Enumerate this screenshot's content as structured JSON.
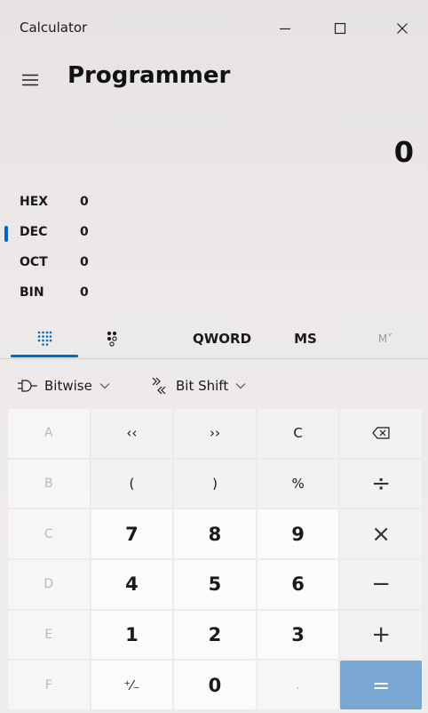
{
  "window": {
    "title": "Calculator"
  },
  "header": {
    "mode": "Programmer"
  },
  "display": {
    "value": "0"
  },
  "radix": [
    {
      "label": "HEX",
      "value": "0",
      "selected": false
    },
    {
      "label": "DEC",
      "value": "0",
      "selected": true
    },
    {
      "label": "OCT",
      "value": "0",
      "selected": false
    },
    {
      "label": "BIN",
      "value": "0",
      "selected": false
    }
  ],
  "toolbar": {
    "word_size": "QWORD",
    "memory_store": "MS",
    "memory_view": "M˅"
  },
  "ops": {
    "bitwise_label": "Bitwise",
    "bitshift_label": "Bit Shift"
  },
  "keypad": [
    [
      "A",
      "‹‹",
      "››",
      "C",
      "⌫"
    ],
    [
      "B",
      "(",
      ")",
      "%",
      "÷"
    ],
    [
      "C",
      "7",
      "8",
      "9",
      "×"
    ],
    [
      "D",
      "4",
      "5",
      "6",
      "−"
    ],
    [
      "E",
      "1",
      "2",
      "3",
      "+"
    ],
    [
      "F",
      "⁺⁄₋",
      "0",
      ".",
      "="
    ]
  ],
  "colors": {
    "accent": "#0067c0",
    "equals_button": "#7aa7d1"
  }
}
